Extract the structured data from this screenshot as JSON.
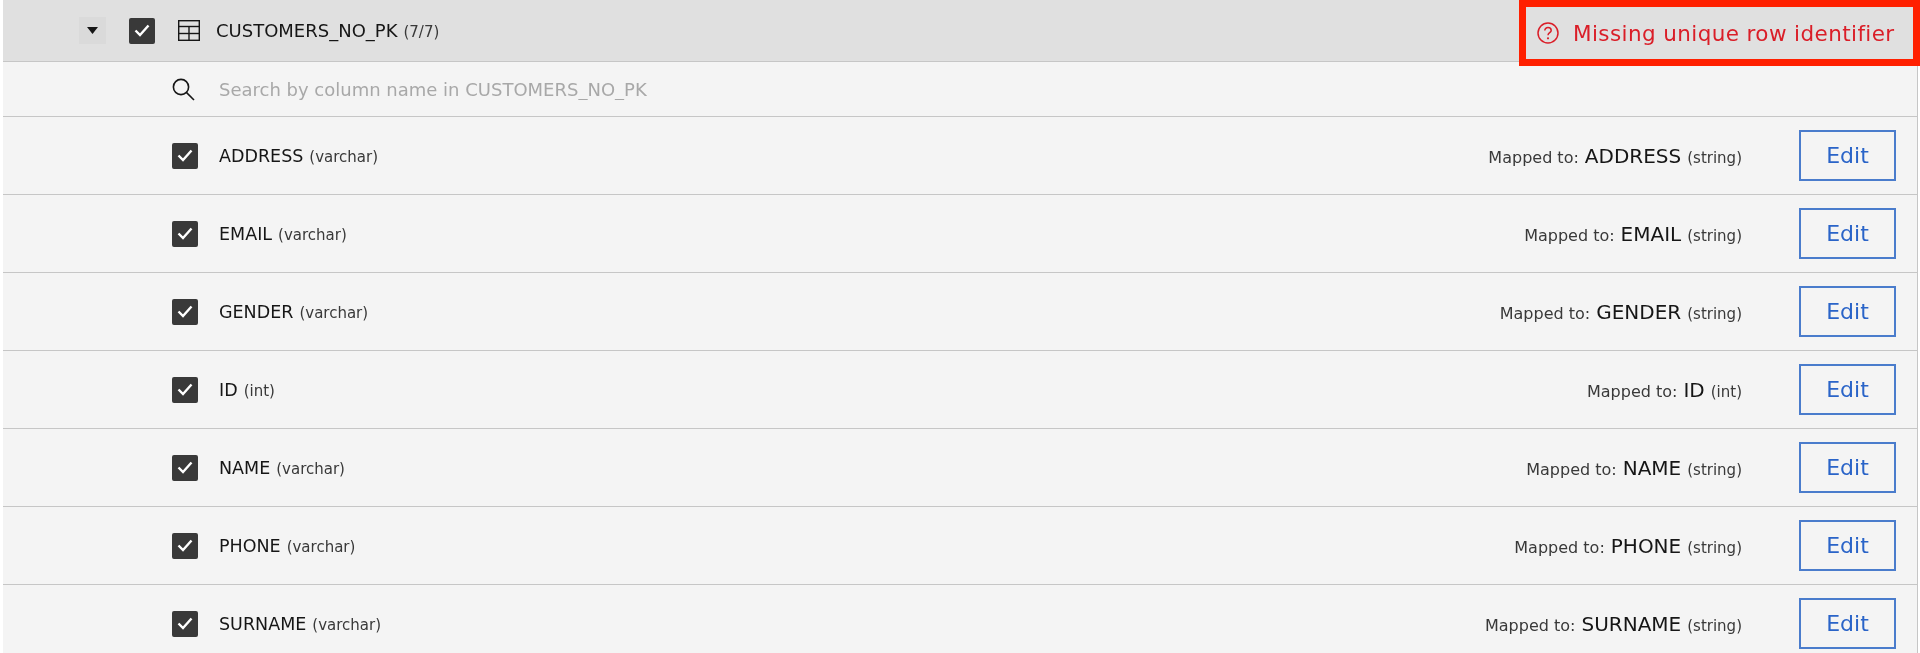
{
  "table": {
    "name": "CUSTOMERS_NO_PK",
    "count": "(7/7)",
    "expanded": true,
    "checked": true,
    "warning": {
      "text": "Missing unique row identifier",
      "highlighted": true
    }
  },
  "search": {
    "placeholder": "Search by column name in CUSTOMERS_NO_PK"
  },
  "columns": [
    {
      "name": "ADDRESS",
      "type": "(varchar)",
      "checked": true,
      "mapped_label": "Mapped to:",
      "mapped_name": "ADDRESS",
      "mapped_type": "(string)",
      "button": "Edit"
    },
    {
      "name": "EMAIL",
      "type": "(varchar)",
      "checked": true,
      "mapped_label": "Mapped to:",
      "mapped_name": "EMAIL",
      "mapped_type": "(string)",
      "button": "Edit"
    },
    {
      "name": "GENDER",
      "type": "(varchar)",
      "checked": true,
      "mapped_label": "Mapped to:",
      "mapped_name": "GENDER",
      "mapped_type": "(string)",
      "button": "Edit"
    },
    {
      "name": "ID",
      "type": "(int)",
      "checked": true,
      "mapped_label": "Mapped to:",
      "mapped_name": "ID",
      "mapped_type": "(int)",
      "button": "Edit"
    },
    {
      "name": "NAME",
      "type": "(varchar)",
      "checked": true,
      "mapped_label": "Mapped to:",
      "mapped_name": "NAME",
      "mapped_type": "(string)",
      "button": "Edit"
    },
    {
      "name": "PHONE",
      "type": "(varchar)",
      "checked": true,
      "mapped_label": "Mapped to:",
      "mapped_name": "PHONE",
      "mapped_type": "(string)",
      "button": "Edit"
    },
    {
      "name": "SURNAME",
      "type": "(varchar)",
      "checked": true,
      "mapped_label": "Mapped to:",
      "mapped_name": "SURNAME",
      "mapped_type": "(string)",
      "button": "Edit"
    }
  ]
}
